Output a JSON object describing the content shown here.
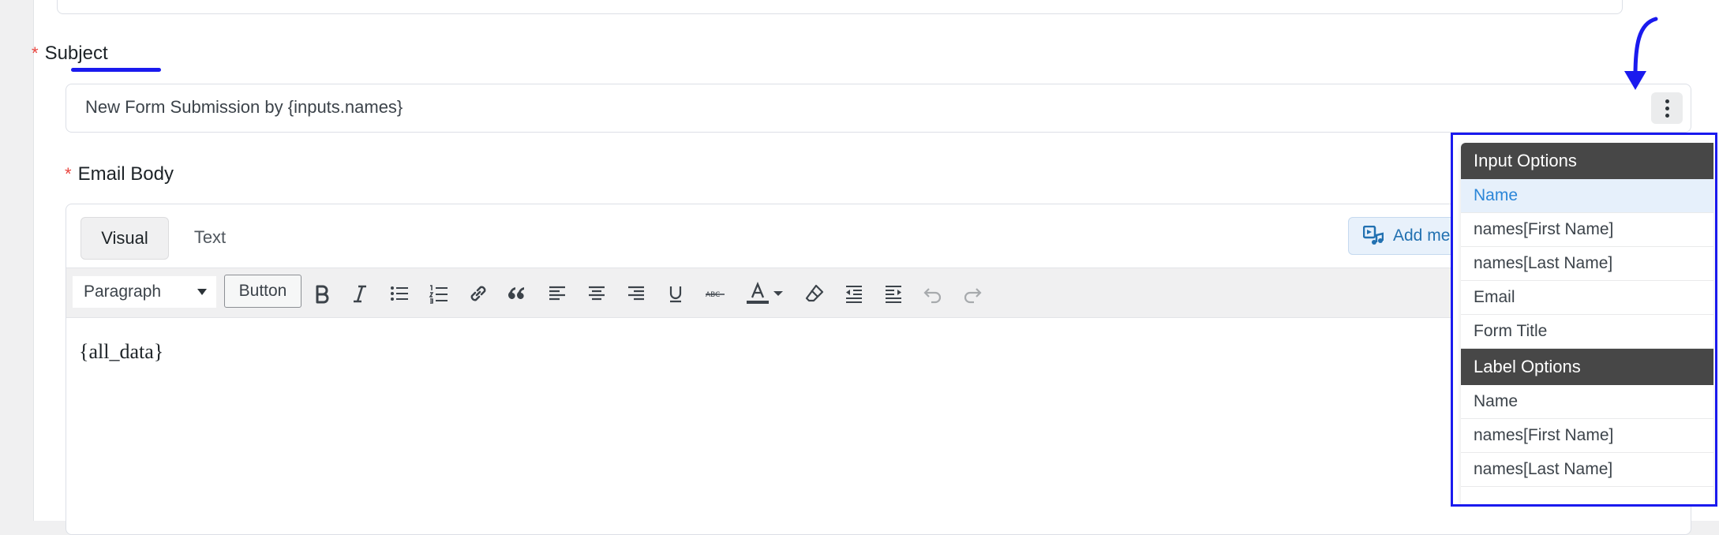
{
  "fields": {
    "subject": {
      "required_marker": "*",
      "label": "Subject",
      "value": "New Form Submission by {inputs.names}"
    },
    "email_body": {
      "required_marker": "*",
      "label": "Email Body"
    }
  },
  "editor": {
    "tabs": [
      "Visual",
      "Text"
    ],
    "active_tab": "Visual",
    "add_media_label": "Add media",
    "format_select_value": "Paragraph",
    "button_label": "Button",
    "toolbar_icons": [
      "bold-icon",
      "italic-icon",
      "bullet-list-icon",
      "numbered-list-icon",
      "link-icon",
      "blockquote-icon",
      "align-left-icon",
      "align-center-icon",
      "align-right-icon",
      "underline-icon",
      "strikethrough-icon",
      "text-color-icon",
      "text-color-dropdown-icon",
      "clear-formatting-icon",
      "outdent-icon",
      "indent-icon",
      "undo-icon",
      "redo-icon"
    ],
    "content": "{all_data}"
  },
  "shortcode_popup": {
    "groups": [
      {
        "title": "Input Options",
        "items": [
          "Name",
          "names[First Name]",
          "names[Last Name]",
          "Email",
          "Form Title"
        ],
        "active_index": 0
      },
      {
        "title": "Label Options",
        "items": [
          "Name",
          "names[First Name]",
          "names[Last Name]"
        ]
      }
    ]
  },
  "colors": {
    "annotation": "#1a1aee",
    "required": "#e9453f",
    "accent": "#2271b1",
    "popup_header": "#474747"
  }
}
